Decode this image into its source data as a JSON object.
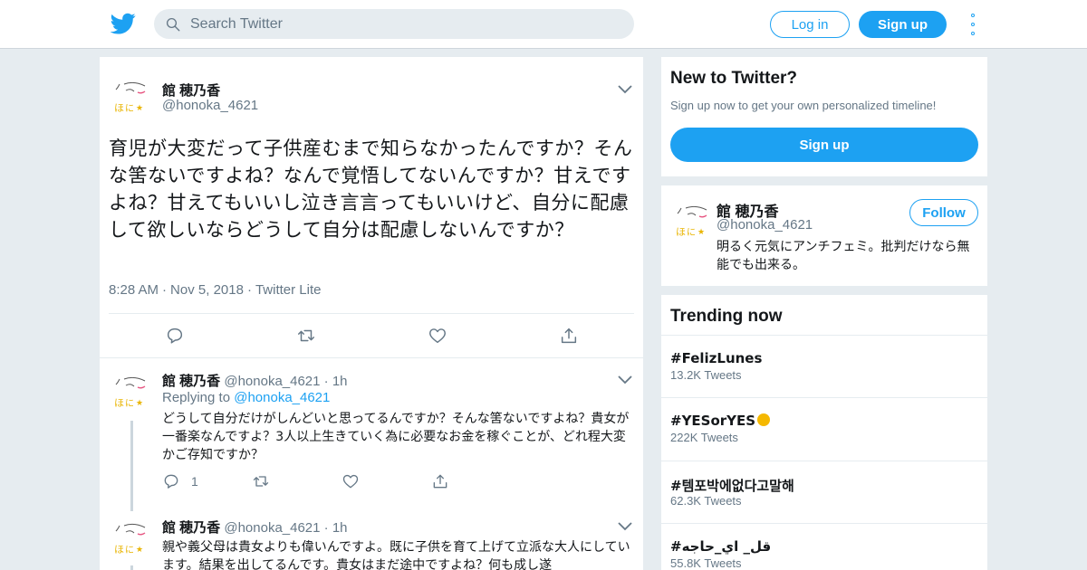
{
  "header": {
    "search_placeholder": "Search Twitter",
    "login_label": "Log in",
    "signup_label": "Sign up"
  },
  "main_tweet": {
    "name": "館 穂乃香",
    "handle": "@honoka_4621",
    "text": "育児が大変だって子供産むまで知らなかったんですか？そんな筈ないですよね？なんで覚悟してないんですか？甘えですよね？甘えてもいいし泣き言言ってもいいけど、自分に配慮して欲しいならどうして自分は配慮しないんですか？",
    "time": "8:28 AM",
    "date": "Nov 5, 2018",
    "source": "Twitter Lite"
  },
  "replies": [
    {
      "name": "館 穂乃香",
      "handle": "@honoka_4621",
      "age": "1h",
      "replying_label": "Replying to",
      "replying_handle": "@honoka_4621",
      "text": "どうして自分だけがしんどいと思ってるんですか？そんな筈ないですよね？貴女が一番楽なんですよ？3人以上生きていく為に必要なお金を稼ぐことが、どれ程大変かご存知ですか？",
      "reply_count": "1"
    },
    {
      "name": "館 穂乃香",
      "handle": "@honoka_4621",
      "age": "1h",
      "text": "親や義父母は貴女よりも偉いんですよ。既に子供を育て上げて立派な大人にしています。結果を出してるんです。貴女はまだ途中ですよね？何も成し遂"
    }
  ],
  "sidebar": {
    "new_title": "New to Twitter?",
    "new_sub": "Sign up now to get your own personalized timeline!",
    "signup_label": "Sign up",
    "profile": {
      "name": "館 穂乃香",
      "handle": "@honoka_4621",
      "follow_label": "Follow",
      "bio": "明るく元気にアンチフェミ。批判だけなら無能でも出来る。"
    },
    "trending_title": "Trending now",
    "trends": [
      {
        "name": "#FelizLunes",
        "count": "13.2K Tweets"
      },
      {
        "name": "#YESorYES",
        "count": "222K Tweets"
      },
      {
        "name": "#템포박에없다고말해",
        "count": "62.3K Tweets"
      },
      {
        "name": "#قل_ اي_حاجه",
        "count": "55.8K Tweets"
      }
    ]
  },
  "colors": {
    "brand": "#1da1f2",
    "background": "#e6ecf0",
    "muted": "#657786"
  }
}
